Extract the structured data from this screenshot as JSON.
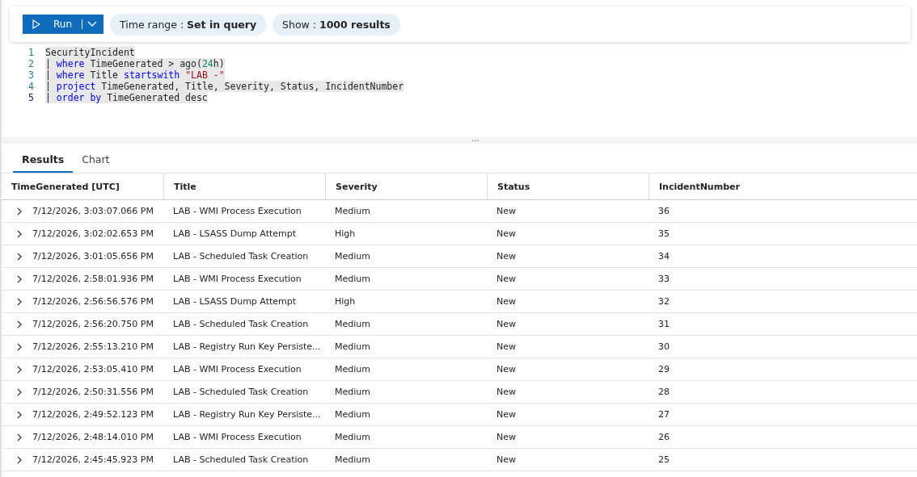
{
  "toolbar": {
    "run_button": {
      "label": "Run"
    },
    "pills": [
      {
        "label": "Time range : ",
        "value": "Set in query"
      },
      {
        "label": "Show : ",
        "value": "1000 results"
      }
    ]
  },
  "editor": {
    "lines": [
      {
        "number": "1",
        "current": false,
        "tokens": [
          {
            "kind": "plain",
            "text": "SecurityIncident"
          }
        ]
      },
      {
        "number": "2",
        "current": false,
        "tokens": [
          {
            "kind": "plain",
            "text": "| "
          },
          {
            "kind": "keyword",
            "text": "where"
          },
          {
            "kind": "plain",
            "text": " TimeGenerated > ago("
          },
          {
            "kind": "number",
            "text": "24"
          },
          {
            "kind": "plain",
            "text": "h)"
          }
        ]
      },
      {
        "number": "3",
        "current": false,
        "tokens": [
          {
            "kind": "plain",
            "text": "| "
          },
          {
            "kind": "keyword",
            "text": "where"
          },
          {
            "kind": "plain",
            "text": " Title "
          },
          {
            "kind": "keyword",
            "text": "startswith"
          },
          {
            "kind": "string",
            "text": " \"LAB -\""
          }
        ]
      },
      {
        "number": "4",
        "current": false,
        "tokens": [
          {
            "kind": "plain",
            "text": "| "
          },
          {
            "kind": "keyword",
            "text": "project"
          },
          {
            "kind": "plain",
            "text": " TimeGenerated, Title, Severity, Status, IncidentNumber"
          }
        ]
      },
      {
        "number": "5",
        "current": true,
        "tokens": [
          {
            "kind": "plain",
            "text": "| "
          },
          {
            "kind": "keyword",
            "text": "order by"
          },
          {
            "kind": "plain",
            "text": " TimeGenerated desc"
          }
        ]
      }
    ]
  },
  "splitter": {
    "label": "..."
  },
  "tabs": [
    {
      "label": "Results",
      "selected": true
    },
    {
      "label": "Chart",
      "selected": false
    }
  ],
  "table": {
    "columns": [
      "TimeGenerated [UTC]",
      "Title",
      "Severity",
      "Status",
      "IncidentNumber"
    ],
    "rows": [
      [
        "7/12/2026, 3:03:07.066 PM",
        "LAB - WMI Process Execution",
        "Medium",
        "New",
        "36"
      ],
      [
        "7/12/2026, 3:02:02.653 PM",
        "LAB - LSASS Dump Attempt",
        "High",
        "New",
        "35"
      ],
      [
        "7/12/2026, 3:01:05.656 PM",
        "LAB - Scheduled Task Creation",
        "Medium",
        "New",
        "34"
      ],
      [
        "7/12/2026, 2:58:01.936 PM",
        "LAB - WMI Process Execution",
        "Medium",
        "New",
        "33"
      ],
      [
        "7/12/2026, 2:56:56.576 PM",
        "LAB - LSASS Dump Attempt",
        "High",
        "New",
        "32"
      ],
      [
        "7/12/2026, 2:56:20.750 PM",
        "LAB - Scheduled Task Creation",
        "Medium",
        "New",
        "31"
      ],
      [
        "7/12/2026, 2:55:13.210 PM",
        "LAB - Registry Run Key Persiste...",
        "Medium",
        "New",
        "30"
      ],
      [
        "7/12/2026, 2:53:05.410 PM",
        "LAB - WMI Process Execution",
        "Medium",
        "New",
        "29"
      ],
      [
        "7/12/2026, 2:50:31.556 PM",
        "LAB - Scheduled Task Creation",
        "Medium",
        "New",
        "28"
      ],
      [
        "7/12/2026, 2:49:52.123 PM",
        "LAB - Registry Run Key Persiste...",
        "Medium",
        "New",
        "27"
      ],
      [
        "7/12/2026, 2:48:14.010 PM",
        "LAB - WMI Process Execution",
        "Medium",
        "New",
        "26"
      ],
      [
        "7/12/2026, 2:45:45.923 PM",
        "LAB - Scheduled Task Creation",
        "Medium",
        "New",
        "25"
      ]
    ]
  }
}
